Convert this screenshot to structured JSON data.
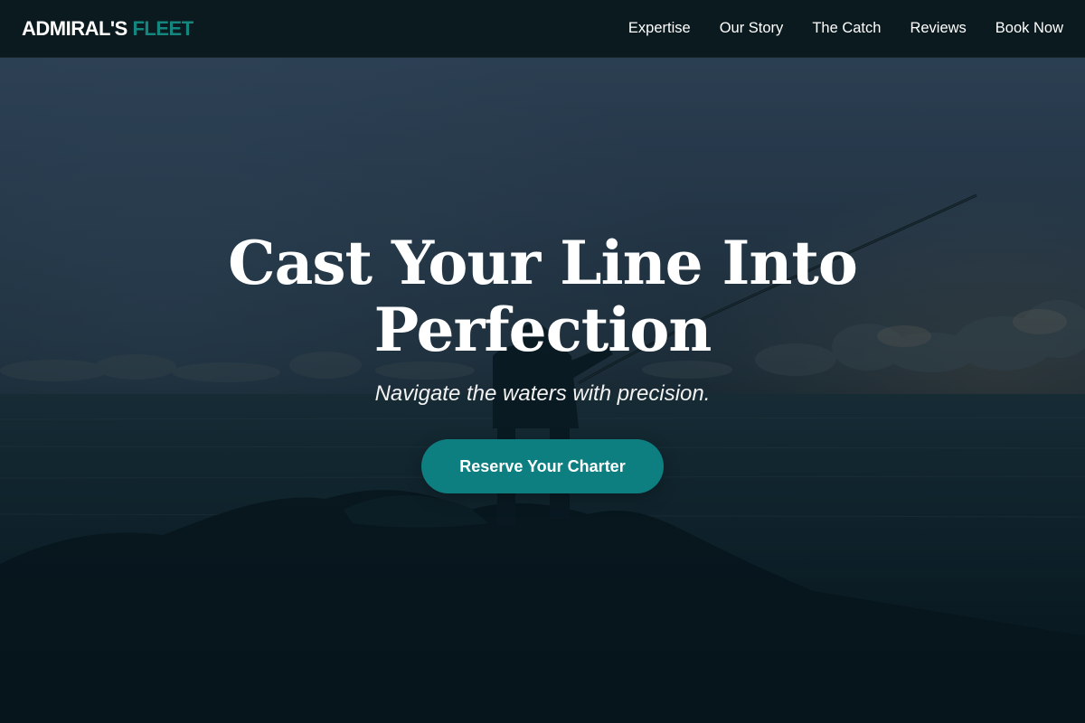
{
  "brand": {
    "name_primary": "ADMIRAL'S",
    "name_accent": "FLEET",
    "accent_color": "#12867f"
  },
  "nav": {
    "items": [
      {
        "label": "Expertise"
      },
      {
        "label": "Our Story"
      },
      {
        "label": "The Catch"
      },
      {
        "label": "Reviews"
      },
      {
        "label": "Book Now"
      }
    ]
  },
  "hero": {
    "title": "Cast Your Line Into Perfection",
    "subtitle": "Navigate the waters with precision.",
    "cta_label": "Reserve Your Charter",
    "cta_color": "#0e7f80",
    "background_scene": "silhouette of angler casting a fishing rod from rocks at dusk over the sea"
  },
  "icons": {
    "hero_image": "angler-silhouette-photo"
  }
}
